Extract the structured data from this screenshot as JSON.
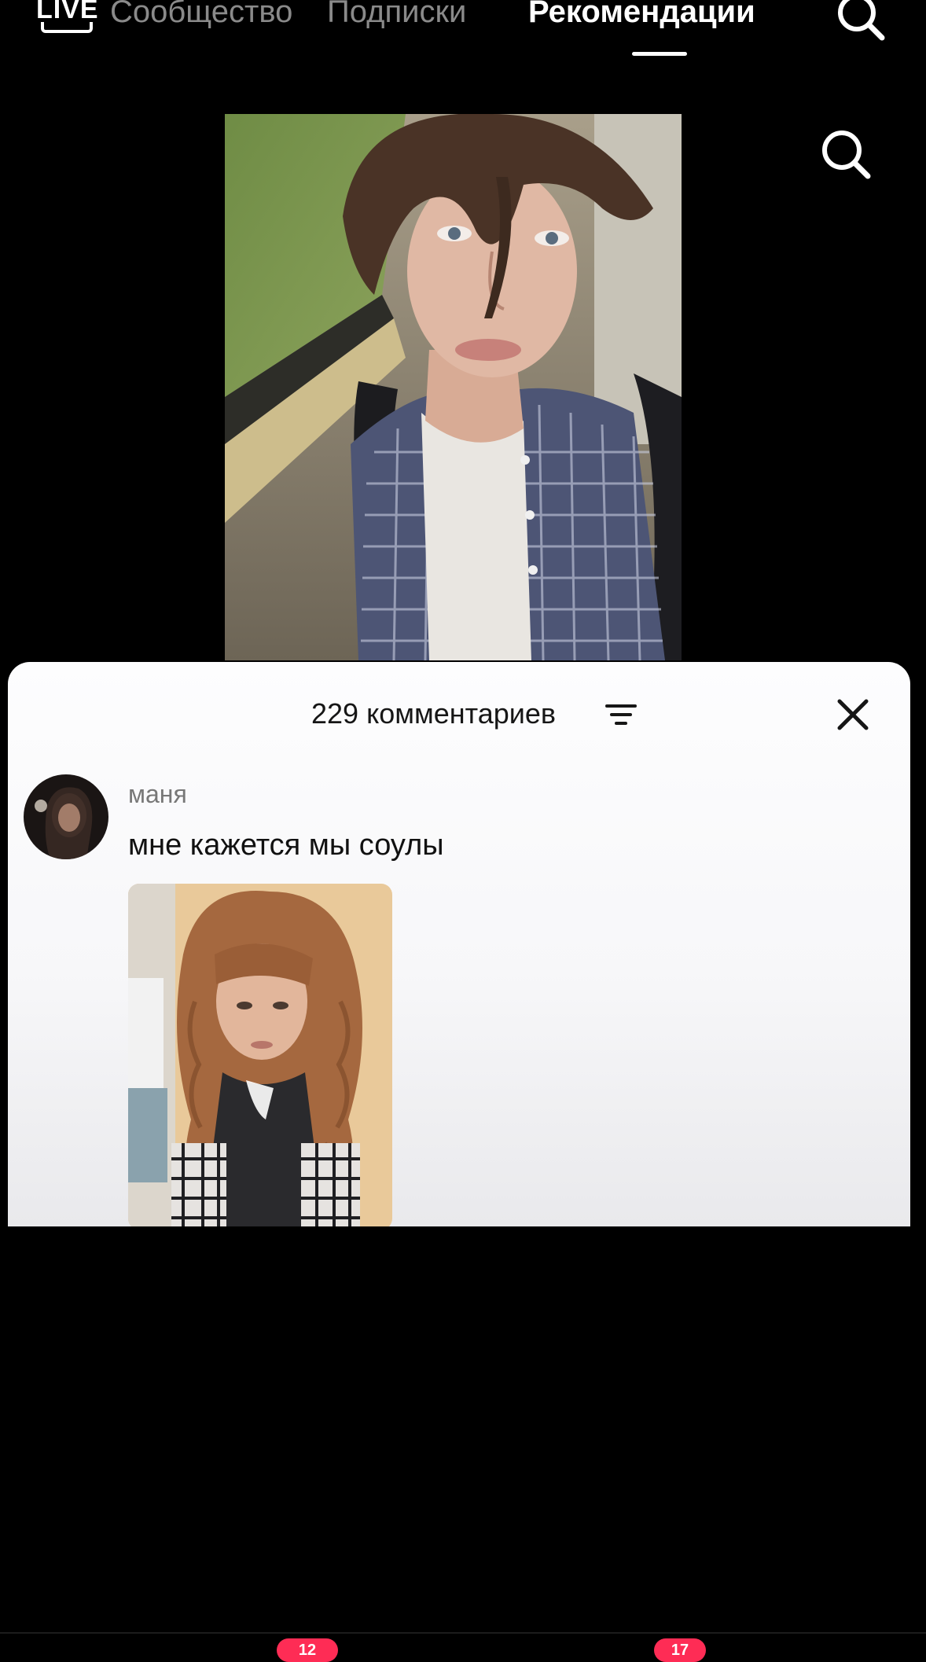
{
  "top_nav": {
    "live_label": "LIVE",
    "tabs": [
      {
        "label": "Сообщество",
        "active": false
      },
      {
        "label": "Подписки",
        "active": false
      },
      {
        "label": "Рекомендации",
        "active": true
      }
    ],
    "search_icon": "search-icon"
  },
  "video": {
    "search_icon": "search-icon"
  },
  "comments": {
    "count_label": "229 комментариев",
    "sort_icon": "filter-lines-icon",
    "close_icon": "close-icon",
    "items": [
      {
        "author": "маня",
        "text": "мне кажется мы соулы",
        "has_photo": true
      }
    ]
  },
  "bottom_bar": {
    "badges": [
      "12",
      "17"
    ],
    "badge_color": "#fe2c55"
  },
  "colors": {
    "background": "#000000",
    "sheet": "#f7f7f9",
    "inactive_tab": "#8a8a8a",
    "accent": "#fe2c55"
  }
}
